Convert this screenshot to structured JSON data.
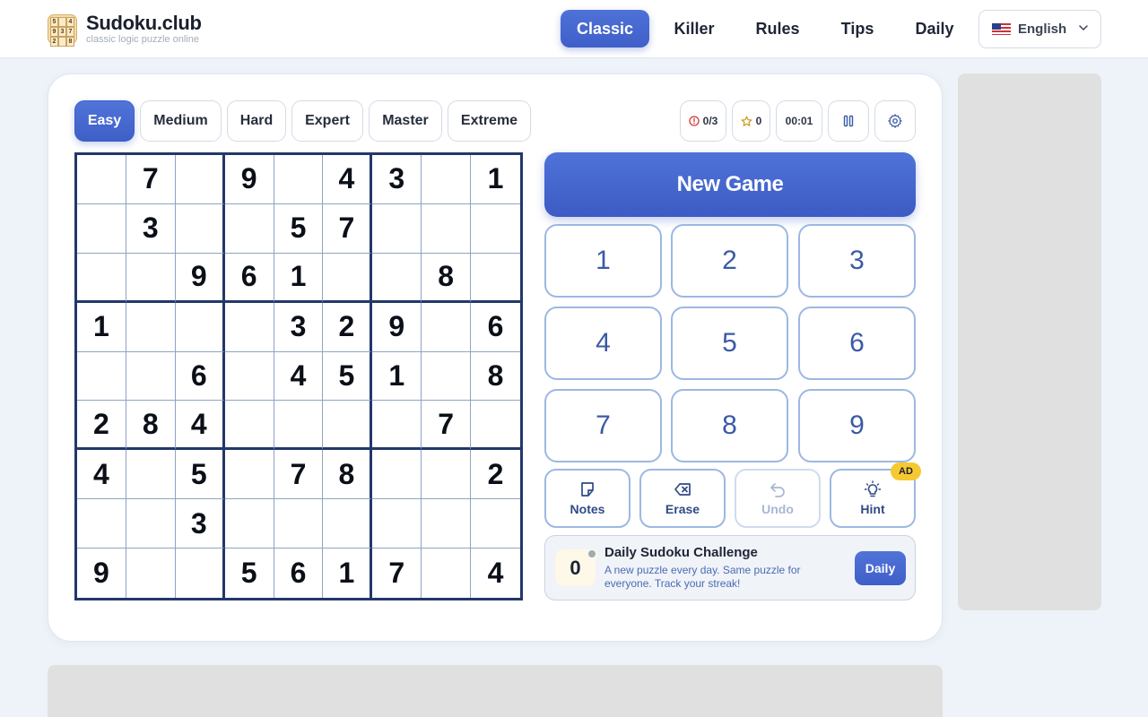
{
  "brand": {
    "title": "Sudoku.club",
    "subtitle": "classic logic puzzle online",
    "logo_digits": [
      "5",
      "",
      "4",
      "9",
      "3",
      "7",
      "2",
      "",
      "8"
    ]
  },
  "nav": {
    "items": [
      {
        "label": "Classic",
        "active": true
      },
      {
        "label": "Killer",
        "active": false
      },
      {
        "label": "Rules",
        "active": false
      },
      {
        "label": "Tips",
        "active": false
      },
      {
        "label": "Daily",
        "active": false
      }
    ],
    "language": "English"
  },
  "difficulty": {
    "items": [
      "Easy",
      "Medium",
      "Hard",
      "Expert",
      "Master",
      "Extreme"
    ],
    "selected": "Easy"
  },
  "stats": {
    "mistakes": "0/3",
    "score": "0",
    "timer": "00:01"
  },
  "board": [
    [
      "",
      "7",
      "",
      "9",
      "",
      "4",
      "3",
      "",
      "1"
    ],
    [
      "",
      "3",
      "",
      "",
      "5",
      "7",
      "",
      "",
      ""
    ],
    [
      "",
      "",
      "9",
      "6",
      "1",
      "",
      "",
      "8",
      ""
    ],
    [
      "1",
      "",
      "",
      "",
      "3",
      "2",
      "9",
      "",
      "6"
    ],
    [
      "",
      "",
      "6",
      "",
      "4",
      "5",
      "1",
      "",
      "8"
    ],
    [
      "2",
      "8",
      "4",
      "",
      "",
      "",
      "",
      "7",
      ""
    ],
    [
      "4",
      "",
      "5",
      "",
      "7",
      "8",
      "",
      "",
      "2"
    ],
    [
      "",
      "",
      "3",
      "",
      "",
      "",
      "",
      "",
      ""
    ],
    [
      "9",
      "",
      "",
      "5",
      "6",
      "1",
      "7",
      "",
      "4"
    ]
  ],
  "controls": {
    "new_game": "New Game",
    "numpad": [
      "1",
      "2",
      "3",
      "4",
      "5",
      "6",
      "7",
      "8",
      "9"
    ],
    "tools": {
      "notes": "Notes",
      "erase": "Erase",
      "undo": "Undo",
      "hint": "Hint",
      "hint_badge": "AD"
    }
  },
  "daily": {
    "streak": "0",
    "title": "Daily Sudoku Challenge",
    "description": "A new puzzle every day. Same puzzle for everyone. Track your streak!",
    "button": "Daily"
  },
  "colors": {
    "accent": "#4566cf",
    "grid_border": "#233869",
    "numpad_border": "#9cb8e2",
    "badge": "#f6c932"
  }
}
